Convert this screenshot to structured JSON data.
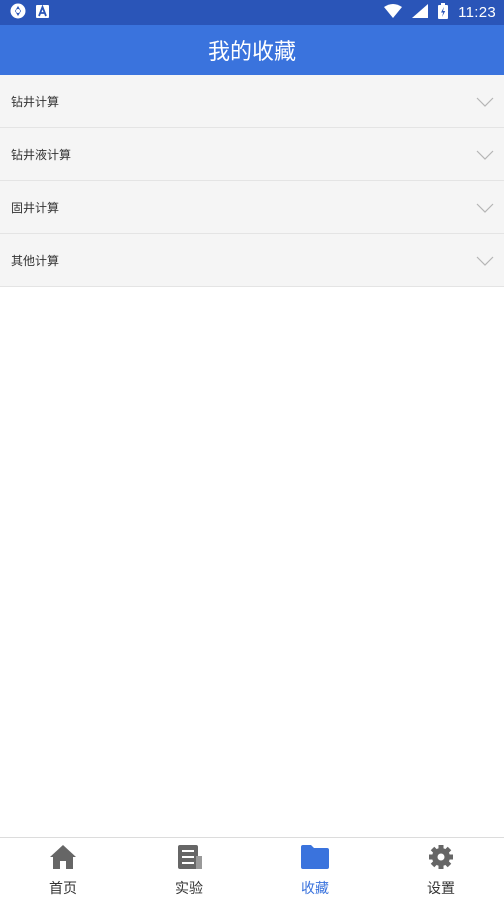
{
  "status_bar": {
    "time": "11:23"
  },
  "header": {
    "title": "我的收藏"
  },
  "favorites": [
    {
      "label": "钻井计算"
    },
    {
      "label": "钻井液计算"
    },
    {
      "label": "固井计算"
    },
    {
      "label": "其他计算"
    }
  ],
  "bottom_nav": [
    {
      "label": "首页",
      "icon": "home-icon"
    },
    {
      "label": "实验",
      "icon": "list-document-icon"
    },
    {
      "label": "收藏",
      "icon": "folder-icon",
      "active": true
    },
    {
      "label": "设置",
      "icon": "gear-icon"
    }
  ],
  "colors": {
    "accent": "#3a73dd",
    "status_bar": "#2a55b8",
    "row_bg": "#f5f5f5"
  }
}
